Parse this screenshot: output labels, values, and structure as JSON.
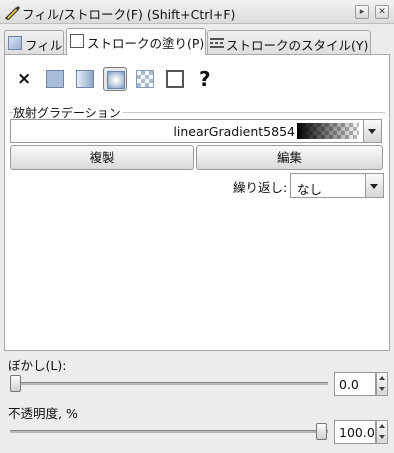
{
  "window": {
    "title": "フィル/ストローク(F) (Shift+Ctrl+F)",
    "pin_button": "▸",
    "close_button": "✕"
  },
  "tabs": [
    {
      "label": "フィル",
      "active": false
    },
    {
      "label": "ストロークの塗り(P)",
      "active": true
    },
    {
      "label": "ストロークのスタイル(Y)",
      "active": false
    }
  ],
  "paint_types": {
    "none_glyph": "×",
    "unset_glyph": "?",
    "selected": "radial-gradient"
  },
  "gradient": {
    "section_label": "放射グラデーション",
    "name": "linearGradient5854",
    "duplicate_label": "複製",
    "edit_label": "編集",
    "repeat_label": "繰り返し:",
    "repeat_value": "なし"
  },
  "blur": {
    "label": "ぼかし(L):",
    "value": "0.0",
    "fraction": 0.0
  },
  "opacity": {
    "label": "不透明度, %",
    "value": "100.0",
    "fraction": 1.0
  },
  "colors": {
    "accent": "#6f85a8",
    "panel": "#ffffff",
    "background": "#ececec"
  }
}
